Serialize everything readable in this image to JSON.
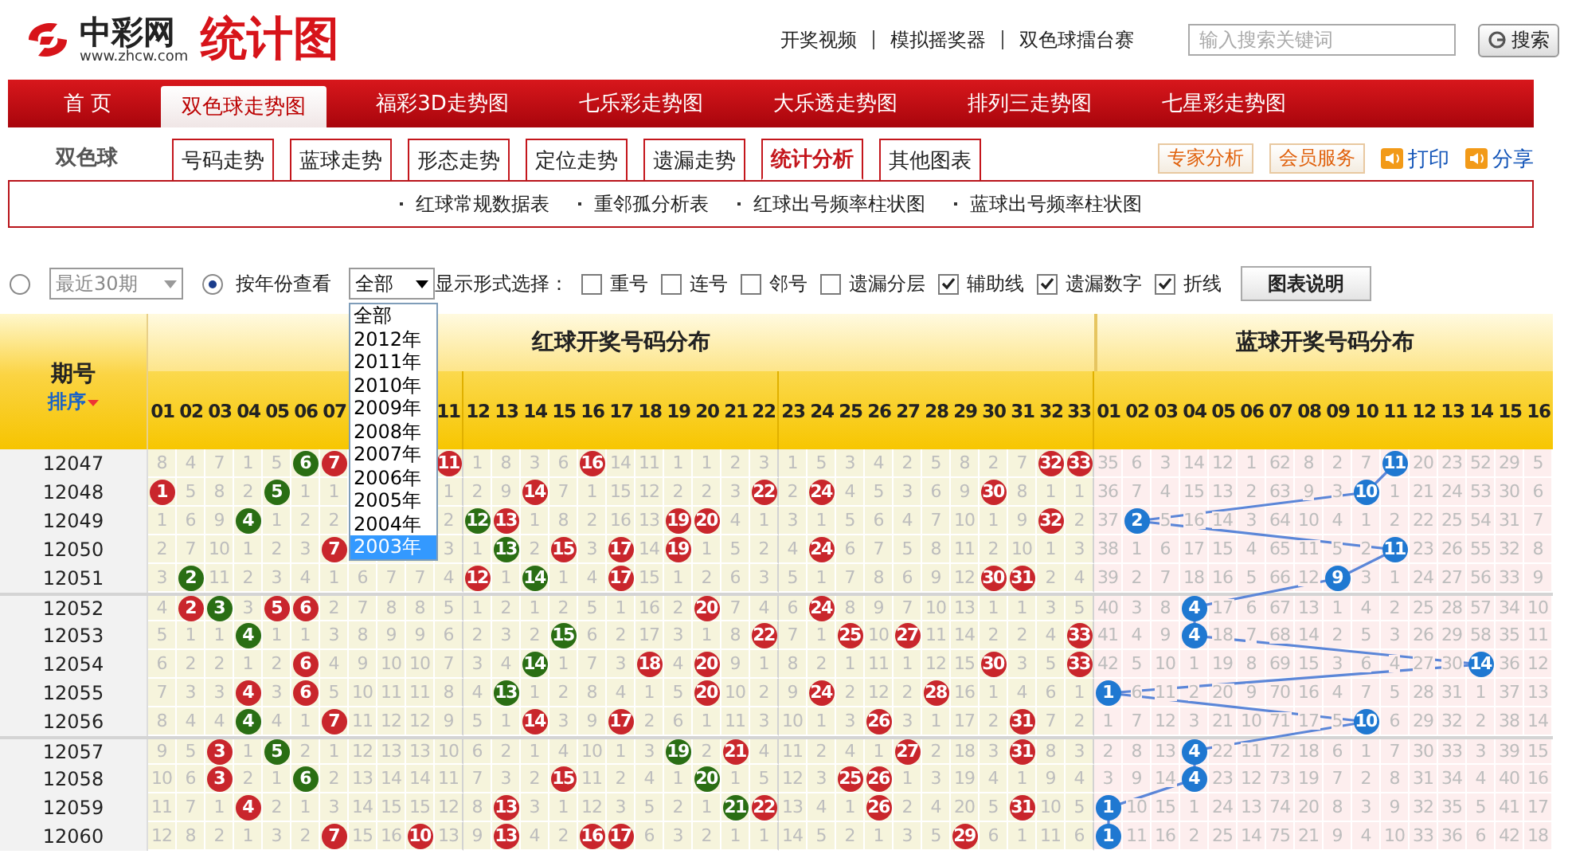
{
  "header": {
    "brand": "中彩网",
    "site": "www.zhcw.com",
    "title": "统计图",
    "links": [
      "开奖视频",
      "模拟摇奖器",
      "双色球擂台赛"
    ],
    "search": {
      "placeholder": "输入搜索关键词",
      "button": "搜索"
    }
  },
  "nav": [
    {
      "label": "首 页",
      "selected": false
    },
    {
      "label": "双色球走势图",
      "selected": true
    },
    {
      "label": "福彩3D走势图",
      "selected": false
    },
    {
      "label": "七乐彩走势图",
      "selected": false
    },
    {
      "label": "大乐透走势图",
      "selected": false
    },
    {
      "label": "排列三走势图",
      "selected": false
    },
    {
      "label": "七星彩走势图",
      "selected": false
    }
  ],
  "subnav": {
    "game": "双色球",
    "tabs": [
      {
        "label": "号码走势",
        "selected": false
      },
      {
        "label": "蓝球走势",
        "selected": false
      },
      {
        "label": "形态走势",
        "selected": false
      },
      {
        "label": "定位走势",
        "selected": false
      },
      {
        "label": "遗漏走势",
        "selected": false
      },
      {
        "label": "统计分析",
        "selected": true
      },
      {
        "label": "其他图表",
        "selected": false
      }
    ],
    "buttons": [
      "专家分析",
      "会员服务"
    ],
    "actions": [
      "打印",
      "分享"
    ]
  },
  "sublinks": [
    "红球常规数据表",
    "重邻孤分析表",
    "红球出号频率柱状图",
    "蓝球出号频率柱状图"
  ],
  "filters": {
    "recent_radio": {
      "selected": false
    },
    "recent_select": {
      "value": "最近30期",
      "disabled": true
    },
    "year_radio": {
      "label": "按年份查看",
      "selected": true
    },
    "year_select": {
      "value": "全部",
      "open": true,
      "options": [
        {
          "label": "全部",
          "highlighted": false
        },
        {
          "label": "2012年",
          "highlighted": false
        },
        {
          "label": "2011年",
          "highlighted": false
        },
        {
          "label": "2010年",
          "highlighted": false
        },
        {
          "label": "2009年",
          "highlighted": false
        },
        {
          "label": "2008年",
          "highlighted": false
        },
        {
          "label": "2007年",
          "highlighted": false
        },
        {
          "label": "2006年",
          "highlighted": false
        },
        {
          "label": "2005年",
          "highlighted": false
        },
        {
          "label": "2004年",
          "highlighted": false
        },
        {
          "label": "2003年",
          "highlighted": true
        }
      ]
    },
    "display_label": "显示形式选择：",
    "options": [
      {
        "label": "重号",
        "checked": false
      },
      {
        "label": "连号",
        "checked": false
      },
      {
        "label": "邻号",
        "checked": false
      },
      {
        "label": "遗漏分层",
        "checked": false
      },
      {
        "label": "辅助线",
        "checked": true
      },
      {
        "label": "遗漏数字",
        "checked": true
      },
      {
        "label": "折线",
        "checked": true
      }
    ],
    "legend_button": "图表说明"
  },
  "table": {
    "period_header": "期号",
    "sort_label": "排序",
    "red_title": "红球开奖号码分布",
    "blue_title": "蓝球开奖号码分布",
    "numbers_covered": true,
    "red_numbers": [
      "01",
      "02",
      "03",
      "04",
      "05",
      "06",
      "07",
      "11",
      "12",
      "13",
      "14",
      "15",
      "16",
      "17",
      "18",
      "19",
      "20",
      "21",
      "22",
      "23",
      "24",
      "25",
      "26",
      "27",
      "28",
      "29",
      "30",
      "31",
      "32",
      "33"
    ],
    "blue_numbers": [
      "01",
      "02",
      "03",
      "04",
      "05",
      "06",
      "07",
      "08",
      "09",
      "10",
      "11",
      "12",
      "13",
      "14",
      "15",
      "16"
    ],
    "rows": [
      {
        "period": "12047",
        "covered": true,
        "red": [
          "8",
          "4",
          "7",
          "1",
          "5",
          {
            "text": "6",
            "color": "#2a6e14"
          },
          {
            "text": "7",
            "color": "#c9262c"
          },
          {
            "text": "11",
            "color": "#c9262c"
          },
          "1",
          "8",
          "3",
          "6",
          {
            "text": "16",
            "color": "#c9262c"
          },
          "14",
          "11",
          "1",
          "1",
          "2",
          "3",
          "1",
          "5",
          "3",
          "4",
          "2",
          "5",
          "8",
          "2",
          "7",
          {
            "text": "32",
            "color": "#c9262c"
          },
          {
            "text": "33",
            "color": "#c9262c"
          }
        ],
        "blue": [
          "35",
          "6",
          "3",
          "14",
          "12",
          "1",
          "62",
          "8",
          "2",
          "7",
          {
            "text": "11",
            "color": "#1f78d1"
          },
          "20",
          "23",
          "52",
          "29",
          "5"
        ]
      },
      {
        "period": "12048",
        "covered": true,
        "red": [
          {
            "text": "1",
            "color": "#c9262c"
          },
          "5",
          "8",
          "2",
          {
            "text": "5",
            "color": "#2a6e14"
          },
          "1",
          "1",
          "1",
          "2",
          "9",
          {
            "text": "14",
            "color": "#c9262c"
          },
          "7",
          "1",
          "15",
          "12",
          "2",
          "2",
          "3",
          {
            "text": "22",
            "color": "#c9262c"
          },
          "2",
          {
            "text": "24",
            "color": "#c9262c"
          },
          "4",
          "5",
          "3",
          "6",
          "9",
          {
            "text": "30",
            "color": "#c9262c"
          },
          "8",
          "1",
          "1"
        ],
        "blue": [
          "36",
          "7",
          "4",
          "15",
          "13",
          "2",
          "63",
          "9",
          "3",
          {
            "text": "10",
            "color": "#1f78d1"
          },
          "1",
          "21",
          "24",
          "53",
          "30",
          "6"
        ]
      },
      {
        "period": "12049",
        "covered": true,
        "red": [
          "1",
          "6",
          "9",
          {
            "text": "4",
            "color": "#2a6e14"
          },
          "1",
          "2",
          "2",
          "2",
          {
            "text": "12",
            "color": "#2a6e14"
          },
          {
            "text": "13",
            "color": "#c9262c"
          },
          "1",
          "8",
          "2",
          "16",
          "13",
          {
            "text": "19",
            "color": "#c9262c"
          },
          {
            "text": "20",
            "color": "#c9262c"
          },
          "4",
          "1",
          "3",
          "1",
          "5",
          "6",
          "4",
          "7",
          "10",
          "1",
          "9",
          {
            "text": "32",
            "color": "#c9262c"
          },
          "2"
        ],
        "blue": [
          "37",
          {
            "text": "2",
            "color": "#1f78d1"
          },
          "5",
          "16",
          "14",
          "3",
          "64",
          "10",
          "4",
          "1",
          "2",
          "22",
          "25",
          "54",
          "31",
          "7"
        ]
      },
      {
        "period": "12050",
        "covered": true,
        "red": [
          "2",
          "7",
          "10",
          "1",
          "2",
          "3",
          {
            "text": "7",
            "color": "#c9262c"
          },
          "3",
          "1",
          {
            "text": "13",
            "color": "#2a6e14"
          },
          "2",
          {
            "text": "15",
            "color": "#c9262c"
          },
          "3",
          {
            "text": "17",
            "color": "#c9262c"
          },
          "14",
          {
            "text": "19",
            "color": "#c9262c"
          },
          "1",
          "5",
          "2",
          "4",
          {
            "text": "24",
            "color": "#c9262c"
          },
          "6",
          "7",
          "5",
          "8",
          "11",
          "2",
          "10",
          "1",
          "3"
        ],
        "blue": [
          "38",
          "1",
          "6",
          "17",
          "15",
          "4",
          "65",
          "11",
          "5",
          "2",
          {
            "text": "11",
            "color": "#1f78d1"
          },
          "23",
          "26",
          "55",
          "32",
          "8"
        ]
      },
      {
        "period": "12051",
        "red": [
          "3",
          {
            "text": "2",
            "color": "#2a6e14"
          },
          "11",
          "2",
          "3",
          "4",
          "1",
          "6",
          "7",
          "7",
          "4",
          {
            "text": "12",
            "color": "#c9262c"
          },
          "1",
          {
            "text": "14",
            "color": "#2a6e14"
          },
          "1",
          "4",
          {
            "text": "17",
            "color": "#c9262c"
          },
          "15",
          "1",
          "2",
          "6",
          "3",
          "5",
          "1",
          "7",
          "8",
          "6",
          "9",
          "12",
          {
            "text": "30",
            "color": "#c9262c"
          },
          {
            "text": "31",
            "color": "#c9262c"
          },
          "2",
          "4"
        ],
        "blue": [
          "39",
          "2",
          "7",
          "18",
          "16",
          "5",
          "66",
          "12",
          {
            "text": "9",
            "color": "#1f78d1"
          },
          "3",
          "1",
          "24",
          "27",
          "56",
          "33",
          "9"
        ]
      },
      {
        "period": "12052",
        "red": [
          "4",
          {
            "text": "2",
            "color": "#c9262c"
          },
          {
            "text": "3",
            "color": "#2a6e14"
          },
          "3",
          {
            "text": "5",
            "color": "#c9262c"
          },
          {
            "text": "6",
            "color": "#c9262c"
          },
          "2",
          "7",
          "8",
          "8",
          "5",
          "1",
          "2",
          "1",
          "2",
          "5",
          "1",
          "16",
          "2",
          {
            "text": "20",
            "color": "#c9262c"
          },
          "7",
          "4",
          "6",
          {
            "text": "24",
            "color": "#c9262c"
          },
          "8",
          "9",
          "7",
          "10",
          "13",
          "1",
          "1",
          "3",
          "5"
        ],
        "blue": [
          "40",
          "3",
          "8",
          {
            "text": "4",
            "color": "#1f78d1"
          },
          "17",
          "6",
          "67",
          "13",
          "1",
          "4",
          "2",
          "25",
          "28",
          "57",
          "34",
          "10"
        ]
      },
      {
        "period": "12053",
        "red": [
          "5",
          "1",
          "1",
          {
            "text": "4",
            "color": "#2a6e14"
          },
          "1",
          "1",
          "3",
          "8",
          "9",
          "9",
          "6",
          "2",
          "3",
          "2",
          {
            "text": "15",
            "color": "#2a6e14"
          },
          "6",
          "2",
          "17",
          "3",
          "1",
          "8",
          {
            "text": "22",
            "color": "#c9262c"
          },
          "7",
          "1",
          {
            "text": "25",
            "color": "#c9262c"
          },
          "10",
          {
            "text": "27",
            "color": "#c9262c"
          },
          "11",
          "14",
          "2",
          "2",
          "4",
          {
            "text": "33",
            "color": "#c9262c"
          }
        ],
        "blue": [
          "41",
          "4",
          "9",
          {
            "text": "4",
            "color": "#1f78d1"
          },
          "18",
          "7",
          "68",
          "14",
          "2",
          "5",
          "3",
          "26",
          "29",
          "58",
          "35",
          "11"
        ]
      },
      {
        "period": "12054",
        "red": [
          "6",
          "2",
          "2",
          "1",
          "2",
          {
            "text": "6",
            "color": "#c9262c"
          },
          "4",
          "9",
          "10",
          "10",
          "7",
          "3",
          "4",
          {
            "text": "14",
            "color": "#2a6e14"
          },
          "1",
          "7",
          "3",
          {
            "text": "18",
            "color": "#c9262c"
          },
          "4",
          {
            "text": "20",
            "color": "#c9262c"
          },
          "9",
          "1",
          "8",
          "2",
          "1",
          "11",
          "1",
          "12",
          "15",
          {
            "text": "30",
            "color": "#c9262c"
          },
          "3",
          "5",
          {
            "text": "33",
            "color": "#c9262c"
          }
        ],
        "blue": [
          "42",
          "5",
          "10",
          "1",
          "19",
          "8",
          "69",
          "15",
          "3",
          "6",
          "4",
          "27",
          "30",
          {
            "text": "14",
            "color": "#1f78d1"
          },
          "36",
          "12"
        ]
      },
      {
        "period": "12055",
        "red": [
          "7",
          "3",
          "3",
          {
            "text": "4",
            "color": "#c9262c"
          },
          "3",
          {
            "text": "6",
            "color": "#c9262c"
          },
          "5",
          "10",
          "11",
          "11",
          "8",
          "4",
          {
            "text": "13",
            "color": "#2a6e14"
          },
          "1",
          "2",
          "8",
          "4",
          "1",
          "5",
          {
            "text": "20",
            "color": "#c9262c"
          },
          "10",
          "2",
          "9",
          {
            "text": "24",
            "color": "#c9262c"
          },
          "2",
          "12",
          "2",
          {
            "text": "28",
            "color": "#c9262c"
          },
          "16",
          "1",
          "4",
          "6",
          "1"
        ],
        "blue": [
          {
            "text": "1",
            "color": "#1f78d1"
          },
          "6",
          "11",
          "2",
          "20",
          "9",
          "70",
          "16",
          "4",
          "7",
          "5",
          "28",
          "31",
          "1",
          "37",
          "13"
        ]
      },
      {
        "period": "12056",
        "red": [
          "8",
          "4",
          "4",
          {
            "text": "4",
            "color": "#2a6e14"
          },
          "4",
          "1",
          {
            "text": "7",
            "color": "#c9262c"
          },
          "11",
          "12",
          "12",
          "9",
          "5",
          "1",
          {
            "text": "14",
            "color": "#c9262c"
          },
          "3",
          "9",
          {
            "text": "17",
            "color": "#c9262c"
          },
          "2",
          "6",
          "1",
          "11",
          "3",
          "10",
          "1",
          "3",
          {
            "text": "26",
            "color": "#c9262c"
          },
          "3",
          "1",
          "17",
          "2",
          {
            "text": "31",
            "color": "#c9262c"
          },
          "7",
          "2"
        ],
        "blue": [
          "1",
          "7",
          "12",
          "3",
          "21",
          "10",
          "71",
          "17",
          "5",
          {
            "text": "10",
            "color": "#1f78d1"
          },
          "6",
          "29",
          "32",
          "2",
          "38",
          "14"
        ]
      },
      {
        "period": "12057",
        "red": [
          "9",
          "5",
          {
            "text": "3",
            "color": "#c9262c"
          },
          "1",
          {
            "text": "5",
            "color": "#2a6e14"
          },
          "2",
          "1",
          "12",
          "13",
          "13",
          "10",
          "6",
          "2",
          "1",
          "4",
          "10",
          "1",
          "3",
          {
            "text": "19",
            "color": "#2a6e14"
          },
          "2",
          {
            "text": "21",
            "color": "#c9262c"
          },
          "4",
          "11",
          "2",
          "4",
          "1",
          {
            "text": "27",
            "color": "#c9262c"
          },
          "2",
          "18",
          "3",
          {
            "text": "31",
            "color": "#c9262c"
          },
          "8",
          "3"
        ],
        "blue": [
          "2",
          "8",
          "13",
          {
            "text": "4",
            "color": "#1f78d1"
          },
          "22",
          "11",
          "72",
          "18",
          "6",
          "1",
          "7",
          "30",
          "33",
          "3",
          "39",
          "15"
        ]
      },
      {
        "period": "12058",
        "red": [
          "10",
          "6",
          {
            "text": "3",
            "color": "#c9262c"
          },
          "2",
          "1",
          {
            "text": "6",
            "color": "#2a6e14"
          },
          "2",
          "13",
          "14",
          "14",
          "11",
          "7",
          "3",
          "2",
          {
            "text": "15",
            "color": "#c9262c"
          },
          "11",
          "2",
          "4",
          "1",
          {
            "text": "20",
            "color": "#2a6e14"
          },
          "1",
          "5",
          "12",
          "3",
          {
            "text": "25",
            "color": "#c9262c"
          },
          {
            "text": "26",
            "color": "#c9262c"
          },
          "1",
          "3",
          "19",
          "4",
          "1",
          "9",
          "4"
        ],
        "blue": [
          "3",
          "9",
          "14",
          {
            "text": "4",
            "color": "#1f78d1"
          },
          "23",
          "12",
          "73",
          "19",
          "7",
          "2",
          "8",
          "31",
          "34",
          "4",
          "40",
          "16"
        ]
      },
      {
        "period": "12059",
        "red": [
          "11",
          "7",
          "1",
          {
            "text": "4",
            "color": "#c9262c"
          },
          "2",
          "1",
          "3",
          "14",
          "15",
          "15",
          "12",
          "8",
          {
            "text": "13",
            "color": "#c9262c"
          },
          "3",
          "1",
          "12",
          "3",
          "5",
          "2",
          "1",
          {
            "text": "21",
            "color": "#2a6e14"
          },
          {
            "text": "22",
            "color": "#c9262c"
          },
          "13",
          "4",
          "1",
          {
            "text": "26",
            "color": "#c9262c"
          },
          "2",
          "4",
          "20",
          "5",
          {
            "text": "31",
            "color": "#c9262c"
          },
          "10",
          "5"
        ],
        "blue": [
          {
            "text": "1",
            "color": "#1f78d1"
          },
          "10",
          "15",
          "1",
          "24",
          "13",
          "74",
          "20",
          "8",
          "3",
          "9",
          "32",
          "35",
          "5",
          "41",
          "17"
        ]
      },
      {
        "period": "12060",
        "red": [
          "12",
          "8",
          "2",
          "1",
          "3",
          "2",
          {
            "text": "7",
            "color": "#c9262c"
          },
          "15",
          "16",
          {
            "text": "10",
            "color": "#c9262c"
          },
          "13",
          "9",
          {
            "text": "13",
            "color": "#c9262c"
          },
          "4",
          "2",
          {
            "text": "16",
            "color": "#c9262c"
          },
          {
            "text": "17",
            "color": "#c9262c"
          },
          "6",
          "3",
          "2",
          "1",
          "1",
          "14",
          "5",
          "2",
          "1",
          "3",
          "5",
          {
            "text": "29",
            "color": "#c9262c"
          },
          "6",
          "1",
          "11",
          "6"
        ],
        "blue": [
          {
            "text": "1",
            "color": "#1f78d1"
          },
          "11",
          "16",
          "2",
          "25",
          "14",
          "75",
          "21",
          "9",
          "4",
          "10",
          "33",
          "36",
          "6",
          "42",
          "18"
        ]
      }
    ]
  }
}
